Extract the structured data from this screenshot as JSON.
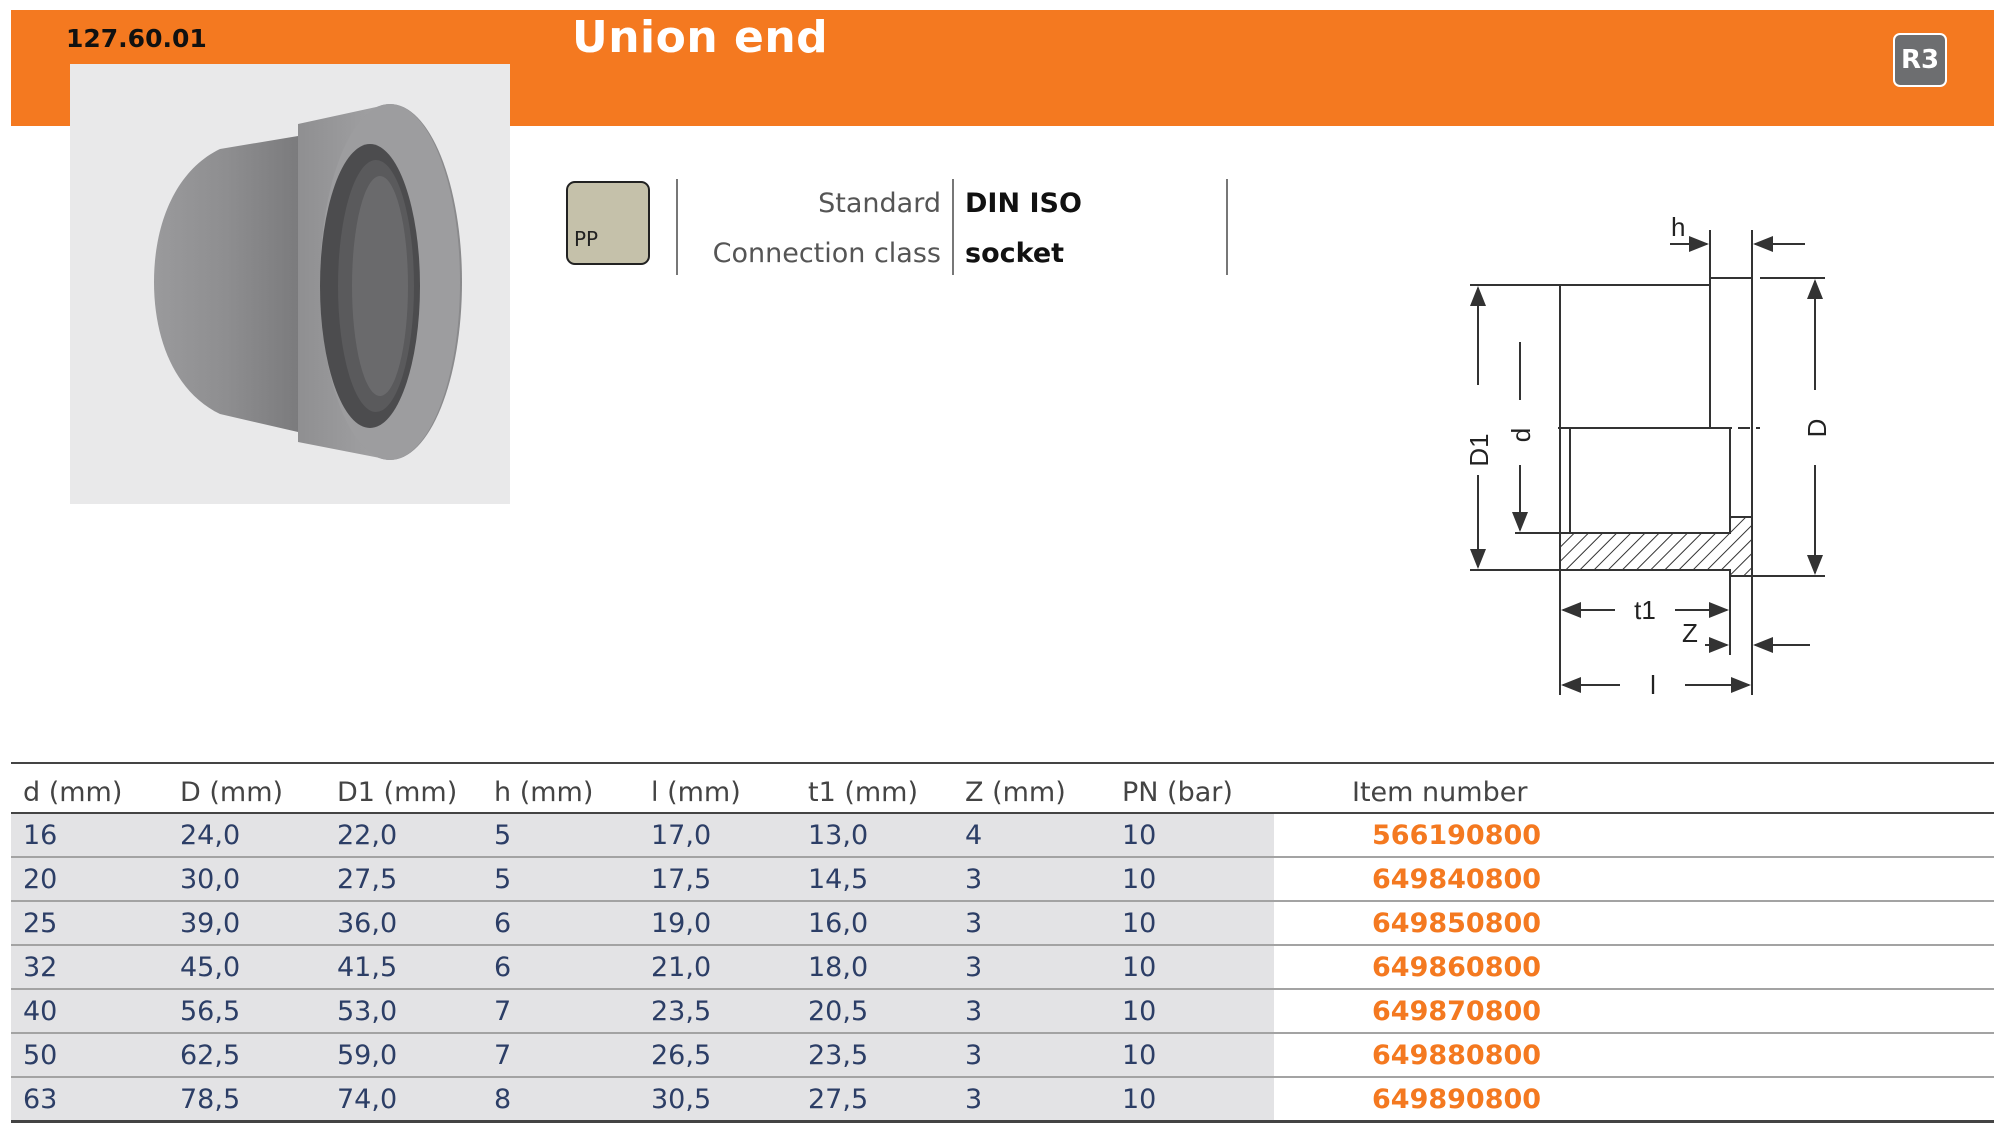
{
  "header": {
    "article_number": "127.60.01",
    "title": "Union end",
    "range_badge": "R3",
    "accent_color": "#f47920"
  },
  "product": {
    "image": "grey-pp-union-end-photo",
    "material": "PP",
    "material_color": "#c5c1aa"
  },
  "specs": {
    "standard_label": "Standard",
    "standard_value": "DIN ISO",
    "connection_label": "Connection class",
    "connection_value": "socket"
  },
  "diagram": {
    "labels": [
      "h",
      "D1",
      "d",
      "D",
      "t1",
      "Z",
      "l"
    ]
  },
  "table": {
    "headers": [
      "d (mm)",
      "D (mm)",
      "D1 (mm)",
      "h (mm)",
      "l (mm)",
      "t1 (mm)",
      "Z (mm)",
      "PN (bar)",
      "Item number"
    ],
    "rows": [
      [
        "16",
        "24,0",
        "22,0",
        "5",
        "17,0",
        "13,0",
        "4",
        "10",
        "566190800"
      ],
      [
        "20",
        "30,0",
        "27,5",
        "5",
        "17,5",
        "14,5",
        "3",
        "10",
        "649840800"
      ],
      [
        "25",
        "39,0",
        "36,0",
        "6",
        "19,0",
        "16,0",
        "3",
        "10",
        "649850800"
      ],
      [
        "32",
        "45,0",
        "41,5",
        "6",
        "21,0",
        "18,0",
        "3",
        "10",
        "649860800"
      ],
      [
        "40",
        "56,5",
        "53,0",
        "7",
        "23,5",
        "20,5",
        "3",
        "10",
        "649870800"
      ],
      [
        "50",
        "62,5",
        "59,0",
        "7",
        "26,5",
        "23,5",
        "3",
        "10",
        "649880800"
      ],
      [
        "63",
        "78,5",
        "74,0",
        "8",
        "30,5",
        "27,5",
        "3",
        "10",
        "649890800"
      ]
    ]
  }
}
